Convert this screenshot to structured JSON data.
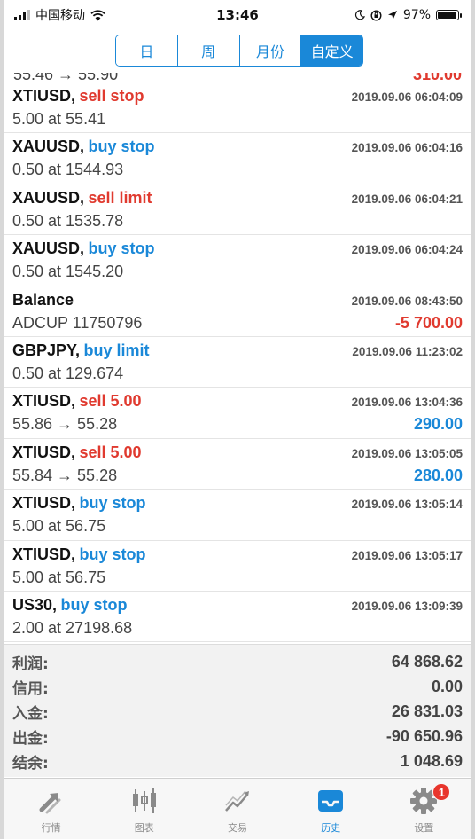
{
  "status_bar": {
    "carrier": "中国移动",
    "time": "13:46",
    "battery_text": "97%",
    "battery_level": 0.97
  },
  "segments": [
    {
      "label": "日",
      "active": false
    },
    {
      "label": "周",
      "active": false
    },
    {
      "label": "月份",
      "active": false
    },
    {
      "label": "自定义",
      "active": true
    }
  ],
  "partial_row": {
    "left": "55.46 → 55.90",
    "right": "310.00"
  },
  "history": [
    {
      "symbol": "XTIUSD,",
      "action": "sell stop",
      "action_type": "sell",
      "timestamp": "2019.09.06 06:04:09",
      "detail": "5.00 at 55.41",
      "amount": ""
    },
    {
      "symbol": "XAUUSD,",
      "action": "buy stop",
      "action_type": "buy",
      "timestamp": "2019.09.06 06:04:16",
      "detail": "0.50 at 1544.93",
      "amount": ""
    },
    {
      "symbol": "XAUUSD,",
      "action": "sell limit",
      "action_type": "sell",
      "timestamp": "2019.09.06 06:04:21",
      "detail": "0.50 at 1535.78",
      "amount": ""
    },
    {
      "symbol": "XAUUSD,",
      "action": "buy stop",
      "action_type": "buy",
      "timestamp": "2019.09.06 06:04:24",
      "detail": "0.50 at 1545.20",
      "amount": ""
    },
    {
      "symbol": "Balance",
      "action": "",
      "action_type": "neutral",
      "timestamp": "2019.09.06 08:43:50",
      "detail": "ADCUP 11750796",
      "amount": "-5 700.00",
      "amount_type": "neg"
    },
    {
      "symbol": "GBPJPY,",
      "action": "buy limit",
      "action_type": "buy",
      "timestamp": "2019.09.06 11:23:02",
      "detail": "0.50 at 129.674",
      "amount": ""
    },
    {
      "symbol": "XTIUSD,",
      "action": "sell 5.00",
      "action_type": "sell",
      "timestamp": "2019.09.06 13:04:36",
      "detail": "55.86 → 55.28",
      "amount": "290.00",
      "amount_type": "pos"
    },
    {
      "symbol": "XTIUSD,",
      "action": "sell 5.00",
      "action_type": "sell",
      "timestamp": "2019.09.06 13:05:05",
      "detail": "55.84 → 55.28",
      "amount": "280.00",
      "amount_type": "pos"
    },
    {
      "symbol": "XTIUSD,",
      "action": "buy stop",
      "action_type": "buy",
      "timestamp": "2019.09.06 13:05:14",
      "detail": "5.00 at 56.75",
      "amount": ""
    },
    {
      "symbol": "XTIUSD,",
      "action": "buy stop",
      "action_type": "buy",
      "timestamp": "2019.09.06 13:05:17",
      "detail": "5.00 at 56.75",
      "amount": ""
    },
    {
      "symbol": "US30,",
      "action": "buy stop",
      "action_type": "buy",
      "timestamp": "2019.09.06 13:09:39",
      "detail": "2.00 at 27198.68",
      "amount": ""
    }
  ],
  "summary": [
    {
      "label": "利润:",
      "value": "64 868.62"
    },
    {
      "label": "信用:",
      "value": "0.00"
    },
    {
      "label": "入金:",
      "value": "26 831.03"
    },
    {
      "label": "出金:",
      "value": "-90 650.96"
    },
    {
      "label": "结余:",
      "value": "1 048.69"
    }
  ],
  "tabs": [
    {
      "label": "行情",
      "icon": "quotes-arrows-icon",
      "active": false
    },
    {
      "label": "图表",
      "icon": "candlestick-chart-icon",
      "active": false
    },
    {
      "label": "交易",
      "icon": "trade-line-chart-icon",
      "active": false
    },
    {
      "label": "历史",
      "icon": "history-inbox-icon",
      "active": true
    },
    {
      "label": "设置",
      "icon": "settings-gear-icon",
      "active": false,
      "badge": "1"
    }
  ],
  "colors": {
    "accent": "#1a88d8",
    "sell": "#e03a2f",
    "badge": "#e8352c"
  }
}
